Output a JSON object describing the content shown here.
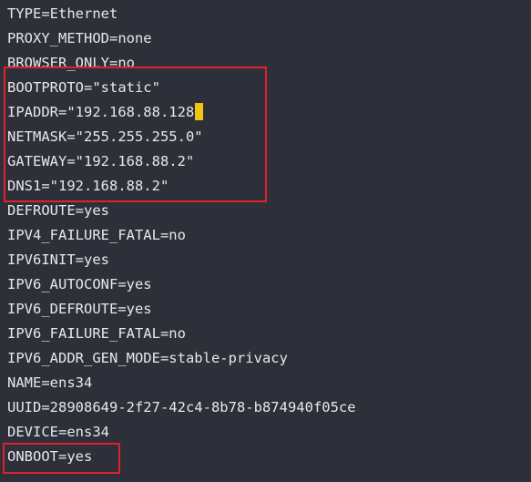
{
  "config_lines": [
    "TYPE=Ethernet",
    "PROXY_METHOD=none",
    "BROWSER_ONLY=no",
    "BOOTPROTO=\"static\"",
    "IPADDR=\"192.168.88.128",
    "NETMASK=\"255.255.255.0\"",
    "GATEWAY=\"192.168.88.2\"",
    "DNS1=\"192.168.88.2\"",
    "DEFROUTE=yes",
    "IPV4_FAILURE_FATAL=no",
    "IPV6INIT=yes",
    "IPV6_AUTOCONF=yes",
    "IPV6_DEFROUTE=yes",
    "IPV6_FAILURE_FATAL=no",
    "IPV6_ADDR_GEN_MODE=stable-privacy",
    "NAME=ens34",
    "UUID=28908649-2f27-42c4-8b78-b874940f05ce",
    "DEVICE=ens34",
    "ONBOOT=yes"
  ],
  "cursor": {
    "glyph": "\"",
    "color": "#f2c40f"
  },
  "colors": {
    "background": "#2d3039",
    "text": "#e6e8ec",
    "highlight_border": "#e0202a"
  }
}
